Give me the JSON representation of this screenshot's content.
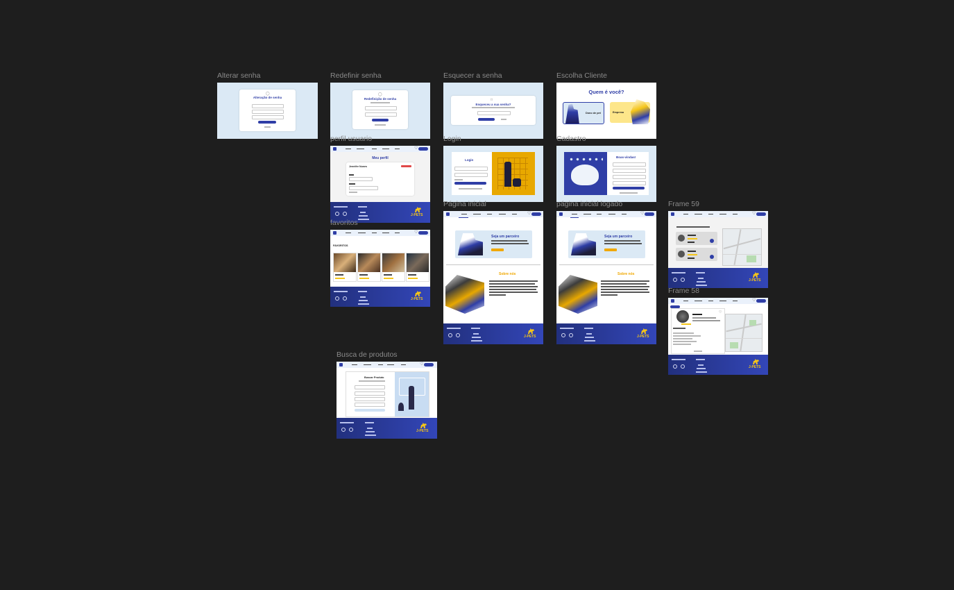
{
  "canvas": {
    "background": "#1e1e1e"
  },
  "colors": {
    "brand_blue": "#2f3ea6",
    "accent_yellow": "#f5c518",
    "accent_orange": "#f0a800",
    "light_bg": "#dbe9f5"
  },
  "frames": {
    "alterar_senha": {
      "label": "Alterar senha",
      "title": "Alteração de senha",
      "button": "Confirmar"
    },
    "redefinir_senha": {
      "label": "Redefinir senha",
      "title": "Redefinição de senha"
    },
    "esquecer_senha": {
      "label": "Esquecer a senha",
      "title": "Esqueceu a sua senha?"
    },
    "escolha_cliente": {
      "label": "Escolha Cliente",
      "title": "Quem é você?",
      "option_1": "Dono de pet",
      "option_2": "Empresa"
    },
    "perfil_usuario": {
      "label": "perfil usuario",
      "title": "Meu perfil",
      "user_name": "Jennifer Nunes"
    },
    "login": {
      "label": "Login",
      "title": "Login"
    },
    "cadastro": {
      "label": "Cadastro",
      "title": "Boas-vindas!"
    },
    "favoritos": {
      "label": "favoritos",
      "section_title": "FAVORITOS"
    },
    "pagina_inicial": {
      "label": "Página inicial",
      "banner_title": "Seja um parceiro",
      "about_title": "Sobre nós"
    },
    "pagina_inicial_logado": {
      "label": "página inicial logado",
      "banner_title": "Seja um parceiro",
      "about_title": "Sobre nós"
    },
    "frame_59": {
      "label": "Frame 59"
    },
    "frame_58": {
      "label": "Frame 58"
    },
    "busca_produtos": {
      "label": "Busca de produtos",
      "title": "Buscar Produto"
    }
  },
  "footer": {
    "logo_text": "J-PETS"
  }
}
